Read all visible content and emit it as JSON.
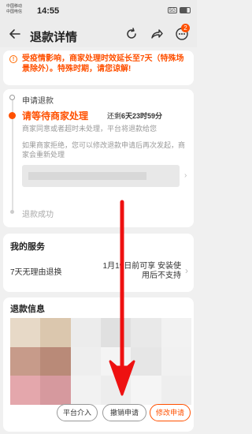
{
  "status_bar": {
    "carrier_1": "中国移动",
    "carrier_2": "中国电信",
    "time": "14:55",
    "signal": "5G",
    "battery": "",
    "battery_icon": "battery-icon"
  },
  "nav": {
    "title": "退款详情",
    "back_icon": "back-arrow-icon",
    "refresh_icon": "refresh-icon",
    "share_icon": "share-icon",
    "more_icon": "more-icon",
    "badge": "2"
  },
  "notice": {
    "icon": "info-icon",
    "text": "受疫情影响，商家处理时效延长至7天（特殊场景除外）。特殊时期，请您谅解!"
  },
  "progress": {
    "step_start": "申请退款",
    "step_current": "请等待商家处理",
    "countdown_prefix": "还剩",
    "countdown_value": "6天23时59分",
    "desc_1": "商家同意或者超时未处理，平台将退款给您",
    "desc_2": "如果商家拒绝，您可以修改退款申请后再次发起，商家会重新处理",
    "step_end": "退款成功"
  },
  "service": {
    "title": "我的服务",
    "name": "7天无理由退换",
    "note": "1月19日前可享 安装使用后不支持"
  },
  "refund": {
    "title": "退款信息"
  },
  "buttons": {
    "platform": "平台介入",
    "cancel": "撤销申请",
    "modify": "修改申请"
  },
  "colors": {
    "accent": "#ff5000",
    "annotation_arrow": "#ee1111"
  }
}
